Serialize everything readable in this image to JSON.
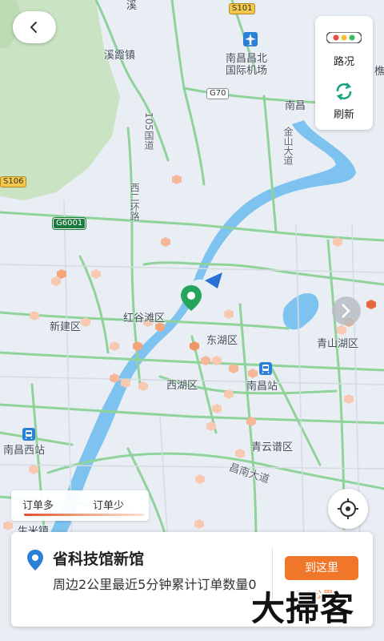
{
  "map": {
    "place_labels": [
      {
        "name": "xixia-label",
        "text": "溪霞镇"
      },
      {
        "name": "airport-label-1",
        "text": "南昌昌北"
      },
      {
        "name": "airport-label-2",
        "text": "国际机场"
      },
      {
        "name": "nanchang-top-label",
        "text": "南昌"
      },
      {
        "name": "jinshan-label",
        "text": "金山大道"
      },
      {
        "name": "road105-label",
        "text": "105国道"
      },
      {
        "name": "xihuan-label",
        "text": "西二环路"
      },
      {
        "name": "honggutan-label",
        "text": "红谷滩区"
      },
      {
        "name": "xinjian-label",
        "text": "新建区"
      },
      {
        "name": "donghu-label",
        "text": "东湖区"
      },
      {
        "name": "qingshanhu-label",
        "text": "青山湖区"
      },
      {
        "name": "xihu-label",
        "text": "西湖区"
      },
      {
        "name": "nanchang-station-label",
        "text": "南昌站"
      },
      {
        "name": "west-station-label",
        "text": "南昌西站"
      },
      {
        "name": "qingyunpu-label",
        "text": "青云谱区"
      },
      {
        "name": "changnan-label",
        "text": "昌南大道"
      },
      {
        "name": "shengmi-label",
        "text": "生米镇"
      },
      {
        "name": "top-left-fragment-label",
        "text": "溪"
      },
      {
        "name": "top-right-fragment-label",
        "text": "樵"
      }
    ],
    "shields": [
      {
        "name": "s101-shield",
        "text": "S101"
      },
      {
        "name": "g70-shield",
        "text": "G70"
      },
      {
        "name": "s106-shield",
        "text": "S106"
      },
      {
        "name": "g6001-shield",
        "text": "G6001"
      }
    ],
    "colors": {
      "land": "#e9eef4",
      "water": "#7ec3ef",
      "green": "#c9e3c3",
      "traffic_road": "#8fd39a",
      "heat": "#f5a57b",
      "marker": "#25a55b"
    },
    "icons": [
      "airplane-icon",
      "train-station-icon",
      "location-pin-icon"
    ]
  },
  "back_button": {
    "icon": "chevron-left-icon"
  },
  "right_panel": {
    "traffic_label": "路况",
    "refresh_label": "刷新"
  },
  "legend": {
    "more_label": "订单多",
    "less_label": "订单少"
  },
  "locate_button": {
    "icon": "locate-icon"
  },
  "card": {
    "title": "省科技馆新馆",
    "description": "周边2公里最近5分钟累计订单数量0",
    "go_button": "到这里",
    "distance": "2.0公里"
  },
  "watermark": {
    "text": "大掃客"
  }
}
